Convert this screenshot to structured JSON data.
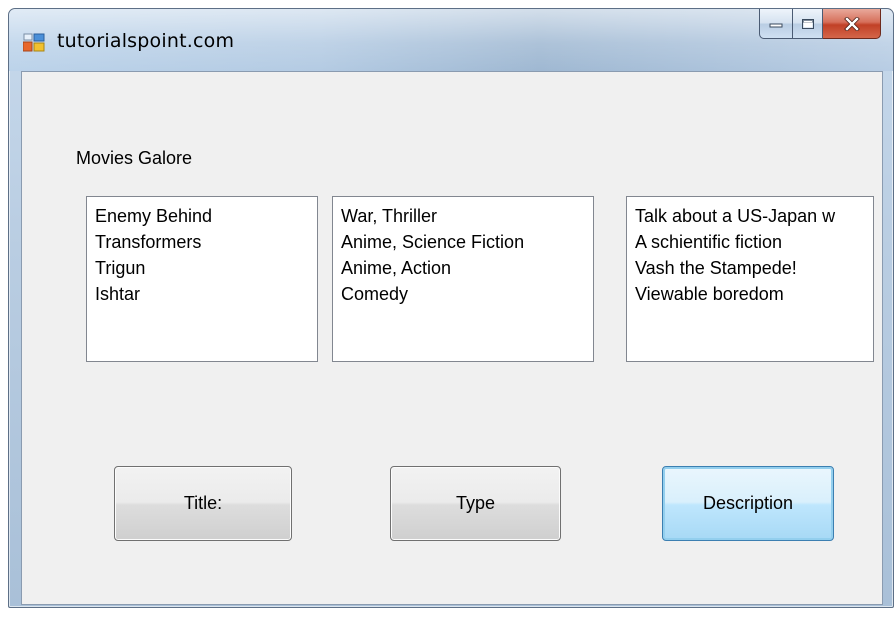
{
  "window": {
    "title": "tutorialspoint.com"
  },
  "form": {
    "heading": "Movies Galore",
    "lists": {
      "titles": [
        "Enemy Behind",
        "Transformers",
        "Trigun",
        "Ishtar"
      ],
      "types": [
        "War, Thriller",
        "Anime, Science Fiction",
        "Anime, Action",
        "Comedy"
      ],
      "descriptions": [
        "Talk about a US-Japan w",
        "A schientific fiction",
        "Vash the Stampede!",
        "Viewable boredom"
      ]
    },
    "buttons": {
      "title": "Title:",
      "type": "Type",
      "description": "Description"
    }
  },
  "icons": {
    "app": "form-app-icon",
    "minimize": "minimize-icon",
    "maximize": "maximize-icon",
    "close": "close-icon"
  },
  "colors": {
    "client_background": "#f0f0f0",
    "focused_button_border": "#3c7fb1",
    "close_button": "#c14127"
  }
}
